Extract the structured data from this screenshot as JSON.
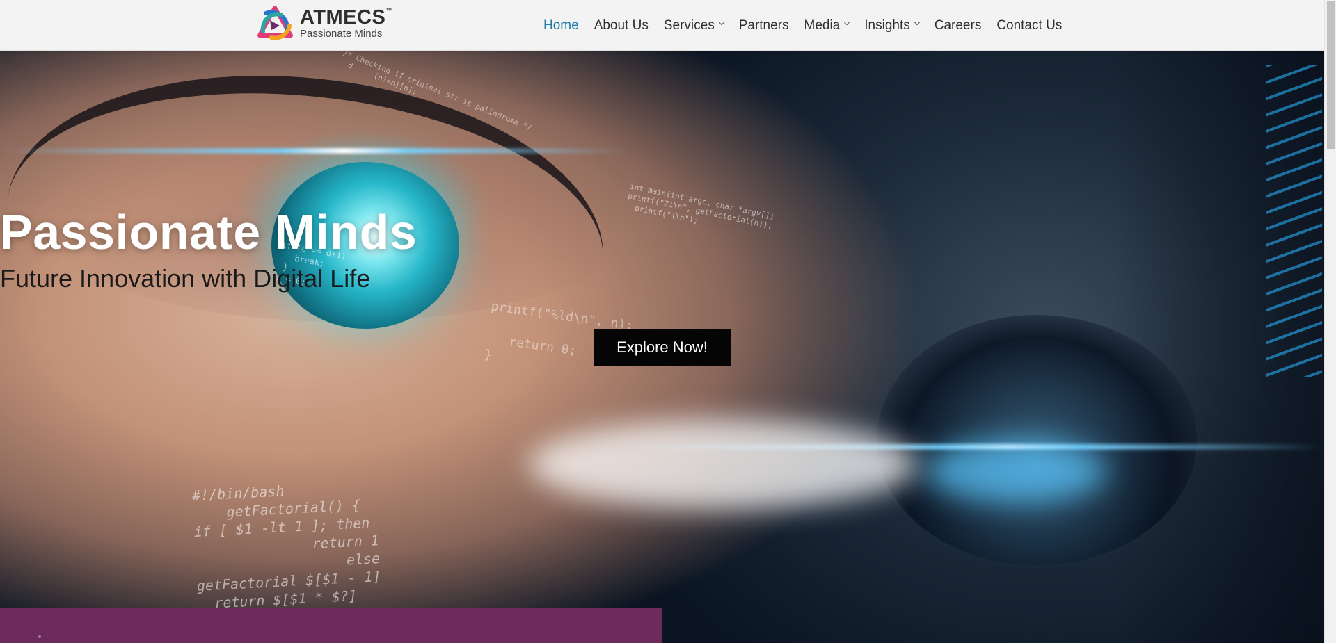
{
  "brand": {
    "name": "ATMECS",
    "trademark": "™",
    "tagline": "Passionate Minds",
    "colors": {
      "purple": "#6d2a5c",
      "nav_active": "#1f7aa8",
      "cta": "#050505"
    }
  },
  "nav": {
    "items": [
      {
        "label": "Home",
        "active": true,
        "has_dropdown": false
      },
      {
        "label": "About Us",
        "active": false,
        "has_dropdown": false
      },
      {
        "label": "Services",
        "active": false,
        "has_dropdown": true
      },
      {
        "label": "Partners",
        "active": false,
        "has_dropdown": false
      },
      {
        "label": "Media",
        "active": false,
        "has_dropdown": true
      },
      {
        "label": "Insights",
        "active": false,
        "has_dropdown": true
      },
      {
        "label": "Careers",
        "active": false,
        "has_dropdown": false
      },
      {
        "label": "Contact Us",
        "active": false,
        "has_dropdown": false
      }
    ]
  },
  "hero": {
    "title": "Passionate Minds",
    "subtitle": "Future Innovation with Digital Life",
    "cta_label": "Explore Now!",
    "background_code": {
      "snippet_bash": "#!/bin/bash\n    getFactorial() {\nif [ $1 -lt 1 ]; then\n              return 1\n                  else\ngetFactorial $[$1 - 1]\n  return $[$1 * $?]",
      "snippet_c": "printf(\"%ld\\n\", n);\n\n   return 0;\n}",
      "snippet_check": "/* Checking if original str is palindrome */\n  d     (n!=n)[n];",
      "snippet_factorial": "int main(int argc, char *argv[])\nprintf(\"Z1\\n\", getFactorial(n));\n  printf(\"1\\n\");",
      "snippet_loop": "if (c == d+1)\n   break;\n }\nr = 0;"
    }
  }
}
